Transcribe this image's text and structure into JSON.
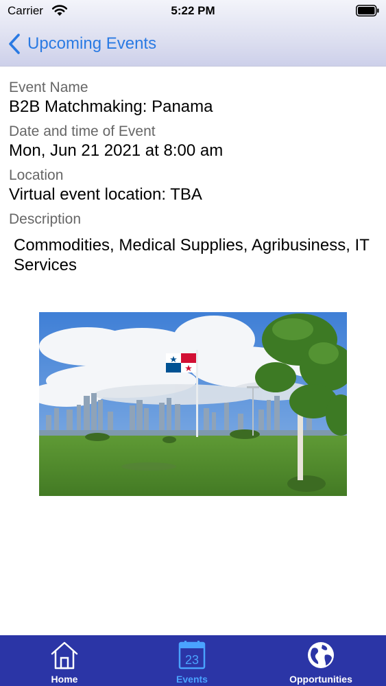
{
  "status_bar": {
    "carrier": "Carrier",
    "time": "5:22 PM"
  },
  "nav": {
    "back_label": "Upcoming Events"
  },
  "event": {
    "name_label": "Event Name",
    "name": "B2B Matchmaking: Panama",
    "date_label": "Date and time of Event",
    "date": "Mon, Jun 21 2021 at 8:00 am",
    "location_label": "Location",
    "location": "Virtual event location: TBA",
    "description_label": "Description",
    "description": "Commodities, Medical Supplies, Agribusiness, IT Services"
  },
  "tabs": [
    {
      "label": "Home",
      "icon": "home-icon"
    },
    {
      "label": "Events",
      "icon": "calendar-icon",
      "badge": "23",
      "active": true
    },
    {
      "label": "Opportunities",
      "icon": "globe-icon"
    }
  ],
  "colors": {
    "accent": "#2a7ae3",
    "tabbar": "#2b35a6",
    "tab_active": "#4aa3ff"
  }
}
